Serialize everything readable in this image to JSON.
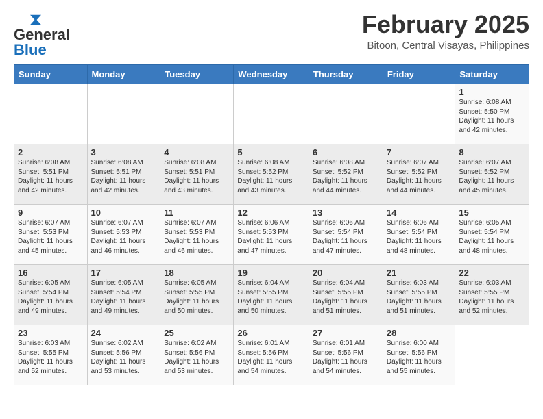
{
  "header": {
    "logo_general": "General",
    "logo_blue": "Blue",
    "title": "February 2025",
    "subtitle": "Bitoon, Central Visayas, Philippines"
  },
  "days_of_week": [
    "Sunday",
    "Monday",
    "Tuesday",
    "Wednesday",
    "Thursday",
    "Friday",
    "Saturday"
  ],
  "weeks": [
    [
      {
        "day": "",
        "info": ""
      },
      {
        "day": "",
        "info": ""
      },
      {
        "day": "",
        "info": ""
      },
      {
        "day": "",
        "info": ""
      },
      {
        "day": "",
        "info": ""
      },
      {
        "day": "",
        "info": ""
      },
      {
        "day": "1",
        "info": "Sunrise: 6:08 AM\nSunset: 5:50 PM\nDaylight: 11 hours\nand 42 minutes."
      }
    ],
    [
      {
        "day": "2",
        "info": "Sunrise: 6:08 AM\nSunset: 5:51 PM\nDaylight: 11 hours\nand 42 minutes."
      },
      {
        "day": "3",
        "info": "Sunrise: 6:08 AM\nSunset: 5:51 PM\nDaylight: 11 hours\nand 42 minutes."
      },
      {
        "day": "4",
        "info": "Sunrise: 6:08 AM\nSunset: 5:51 PM\nDaylight: 11 hours\nand 43 minutes."
      },
      {
        "day": "5",
        "info": "Sunrise: 6:08 AM\nSunset: 5:52 PM\nDaylight: 11 hours\nand 43 minutes."
      },
      {
        "day": "6",
        "info": "Sunrise: 6:08 AM\nSunset: 5:52 PM\nDaylight: 11 hours\nand 44 minutes."
      },
      {
        "day": "7",
        "info": "Sunrise: 6:07 AM\nSunset: 5:52 PM\nDaylight: 11 hours\nand 44 minutes."
      },
      {
        "day": "8",
        "info": "Sunrise: 6:07 AM\nSunset: 5:52 PM\nDaylight: 11 hours\nand 45 minutes."
      }
    ],
    [
      {
        "day": "9",
        "info": "Sunrise: 6:07 AM\nSunset: 5:53 PM\nDaylight: 11 hours\nand 45 minutes."
      },
      {
        "day": "10",
        "info": "Sunrise: 6:07 AM\nSunset: 5:53 PM\nDaylight: 11 hours\nand 46 minutes."
      },
      {
        "day": "11",
        "info": "Sunrise: 6:07 AM\nSunset: 5:53 PM\nDaylight: 11 hours\nand 46 minutes."
      },
      {
        "day": "12",
        "info": "Sunrise: 6:06 AM\nSunset: 5:53 PM\nDaylight: 11 hours\nand 47 minutes."
      },
      {
        "day": "13",
        "info": "Sunrise: 6:06 AM\nSunset: 5:54 PM\nDaylight: 11 hours\nand 47 minutes."
      },
      {
        "day": "14",
        "info": "Sunrise: 6:06 AM\nSunset: 5:54 PM\nDaylight: 11 hours\nand 48 minutes."
      },
      {
        "day": "15",
        "info": "Sunrise: 6:05 AM\nSunset: 5:54 PM\nDaylight: 11 hours\nand 48 minutes."
      }
    ],
    [
      {
        "day": "16",
        "info": "Sunrise: 6:05 AM\nSunset: 5:54 PM\nDaylight: 11 hours\nand 49 minutes."
      },
      {
        "day": "17",
        "info": "Sunrise: 6:05 AM\nSunset: 5:54 PM\nDaylight: 11 hours\nand 49 minutes."
      },
      {
        "day": "18",
        "info": "Sunrise: 6:05 AM\nSunset: 5:55 PM\nDaylight: 11 hours\nand 50 minutes."
      },
      {
        "day": "19",
        "info": "Sunrise: 6:04 AM\nSunset: 5:55 PM\nDaylight: 11 hours\nand 50 minutes."
      },
      {
        "day": "20",
        "info": "Sunrise: 6:04 AM\nSunset: 5:55 PM\nDaylight: 11 hours\nand 51 minutes."
      },
      {
        "day": "21",
        "info": "Sunrise: 6:03 AM\nSunset: 5:55 PM\nDaylight: 11 hours\nand 51 minutes."
      },
      {
        "day": "22",
        "info": "Sunrise: 6:03 AM\nSunset: 5:55 PM\nDaylight: 11 hours\nand 52 minutes."
      }
    ],
    [
      {
        "day": "23",
        "info": "Sunrise: 6:03 AM\nSunset: 5:55 PM\nDaylight: 11 hours\nand 52 minutes."
      },
      {
        "day": "24",
        "info": "Sunrise: 6:02 AM\nSunset: 5:56 PM\nDaylight: 11 hours\nand 53 minutes."
      },
      {
        "day": "25",
        "info": "Sunrise: 6:02 AM\nSunset: 5:56 PM\nDaylight: 11 hours\nand 53 minutes."
      },
      {
        "day": "26",
        "info": "Sunrise: 6:01 AM\nSunset: 5:56 PM\nDaylight: 11 hours\nand 54 minutes."
      },
      {
        "day": "27",
        "info": "Sunrise: 6:01 AM\nSunset: 5:56 PM\nDaylight: 11 hours\nand 54 minutes."
      },
      {
        "day": "28",
        "info": "Sunrise: 6:00 AM\nSunset: 5:56 PM\nDaylight: 11 hours\nand 55 minutes."
      },
      {
        "day": "",
        "info": ""
      }
    ]
  ]
}
